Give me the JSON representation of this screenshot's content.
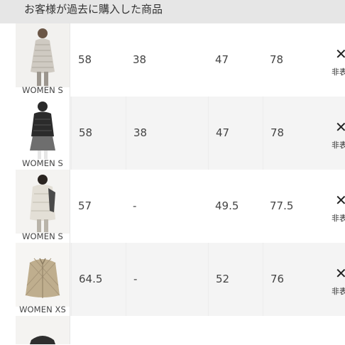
{
  "header": {
    "title": "お客様が過去に購入した商品"
  },
  "rows": [
    {
      "size": "WOMEN S",
      "v1": "58",
      "v2": "38",
      "v3": "47",
      "v4": "78",
      "more_icon": "chevron-right",
      "hide_label": "非表"
    },
    {
      "size": "WOMEN S",
      "v1": "58",
      "v2": "38",
      "v3": "47",
      "v4": "78",
      "more_icon": "chevron-right",
      "hide_label": "非表"
    },
    {
      "size": "WOMEN S",
      "v1": "57",
      "v2": "-",
      "v3": "49.5",
      "v4": "77.5",
      "more_icon": "chevron-right",
      "hide_label": "非表"
    },
    {
      "size": "WOMEN XS",
      "v1": "64.5",
      "v2": "-",
      "v3": "52",
      "v4": "76",
      "more_icon": "chevron-right",
      "hide_label": "非表"
    }
  ],
  "colors": {
    "header_bg": "#e6e6e6",
    "alt_row": "#f4f4f4"
  }
}
